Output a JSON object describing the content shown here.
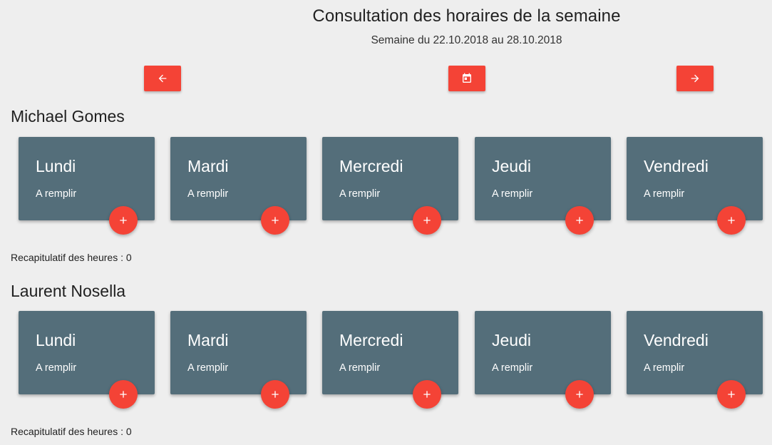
{
  "header": {
    "title": "Consultation des horaires de la semaine",
    "subtitle": "Semaine du 22.10.2018 au 28.10.2018"
  },
  "nav": {
    "prev_icon": "arrow-left-icon",
    "calendar_icon": "calendar-today-icon",
    "next_icon": "arrow-right-icon"
  },
  "colors": {
    "accent": "#f44336",
    "card": "#546e7a",
    "background": "#eeeeee"
  },
  "employees": [
    {
      "name": "Michael Gomes",
      "days": [
        {
          "name": "Lundi",
          "status": "A remplir"
        },
        {
          "name": "Mardi",
          "status": "A remplir"
        },
        {
          "name": "Mercredi",
          "status": "A remplir"
        },
        {
          "name": "Jeudi",
          "status": "A remplir"
        },
        {
          "name": "Vendredi",
          "status": "A remplir"
        }
      ],
      "recap_label": "Recapitulatif des heures :",
      "recap_value": "0"
    },
    {
      "name": "Laurent Nosella",
      "days": [
        {
          "name": "Lundi",
          "status": "A remplir"
        },
        {
          "name": "Mardi",
          "status": "A remplir"
        },
        {
          "name": "Mercredi",
          "status": "A remplir"
        },
        {
          "name": "Jeudi",
          "status": "A remplir"
        },
        {
          "name": "Vendredi",
          "status": "A remplir"
        }
      ],
      "recap_label": "Recapitulatif des heures :",
      "recap_value": "0"
    }
  ]
}
